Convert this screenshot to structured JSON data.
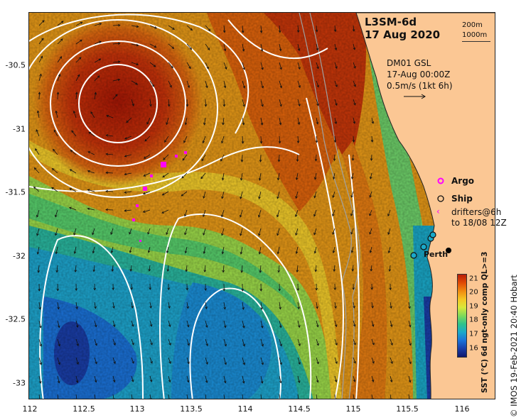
{
  "map": {
    "title_line1": "L3SM-6d",
    "title_line2": "17 Aug 2020",
    "contour_scale_a": "200m",
    "contour_scale_b": "1000m",
    "vector_info_line1": "DM01 GSL",
    "vector_info_line2": "17-Aug 00:00Z",
    "vector_info_line3": "0.5m/s (1kt 6h)",
    "legend": {
      "argo": "Argo",
      "ship": "Ship",
      "drifters_line1": "drifters@6h",
      "drifters_line2": "to 18/08 12Z"
    },
    "place_label": "Perth",
    "lon_ticks": [
      "112",
      "112.5",
      "113",
      "113.5",
      "114",
      "114.5",
      "115",
      "115.5",
      "116"
    ],
    "lat_ticks": [
      "-30.5",
      "-31",
      "-31.5",
      "-32",
      "-32.5",
      "-33"
    ],
    "colorbar": {
      "ticks": [
        "21",
        "20",
        "19",
        "18",
        "17",
        "16"
      ],
      "label": "SST (°C) 6d ngt-only comp QL>=3",
      "colors": [
        "#b81e07",
        "#e04a05",
        "#f08a10",
        "#f5c523",
        "#d8e83a",
        "#7fd95a",
        "#2ec38a",
        "#1aa9c9",
        "#1b72d8",
        "#1a3ea8",
        "#10186e"
      ]
    },
    "credit": "© IMOS 19-Feb-2021 20:40 Hobart",
    "colors": {
      "land": "#fbc794",
      "contour": "#ffffff",
      "argo_marker": "#ff00ff",
      "drifter": "#ff00ff",
      "bathy": "#a0a0a0"
    }
  }
}
